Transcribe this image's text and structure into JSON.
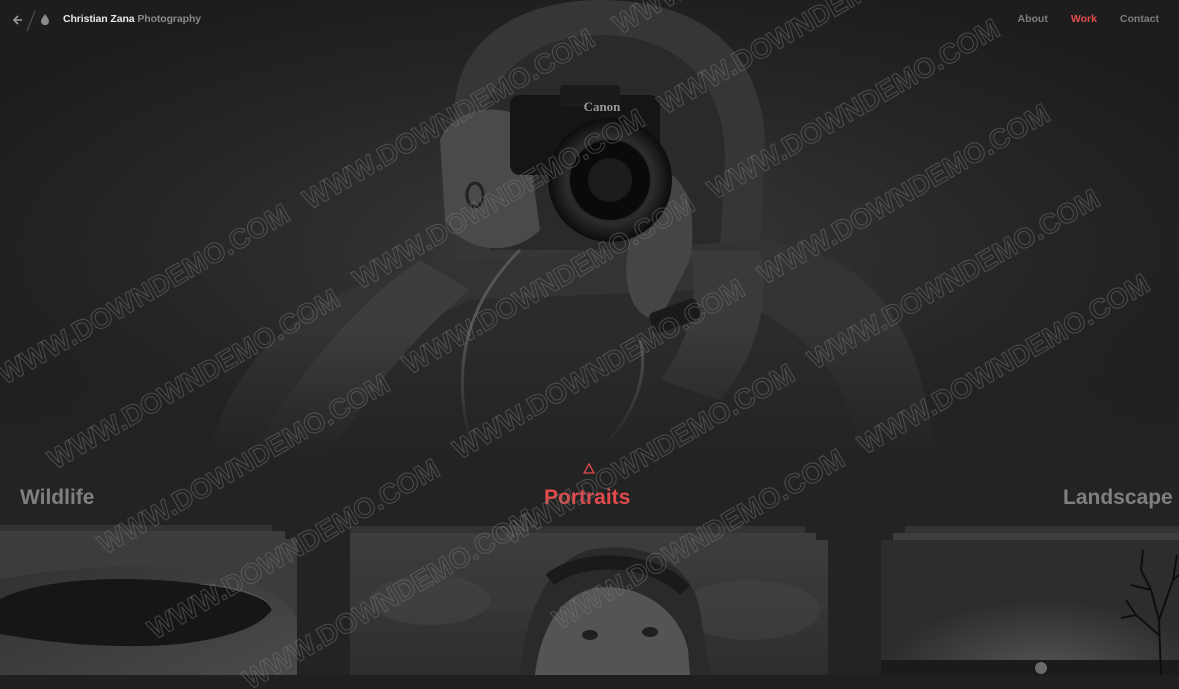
{
  "header": {
    "back_icon": "arrow-left-icon",
    "drop_icon": "drop-icon",
    "brand_name": "Christian Zana",
    "brand_sub": "Photography"
  },
  "nav": {
    "items": [
      {
        "label": "About",
        "active": false
      },
      {
        "label": "Work",
        "active": true
      },
      {
        "label": "Contact",
        "active": false
      }
    ]
  },
  "hero": {
    "camera_brand": "Canon"
  },
  "gallery": {
    "categories": [
      {
        "label": "Wildlife",
        "active": false
      },
      {
        "label": "Portraits",
        "active": true
      },
      {
        "label": "Landscape",
        "active": false
      }
    ],
    "indicator_icon": "triangle-up-outline-icon"
  },
  "watermark": {
    "text": "WWW.DOWNDEMO.COM"
  },
  "colors": {
    "background": "#232323",
    "accent": "#e74c4c",
    "muted_text": "#7f7f7f",
    "brand_text": "#e8e8e8"
  }
}
